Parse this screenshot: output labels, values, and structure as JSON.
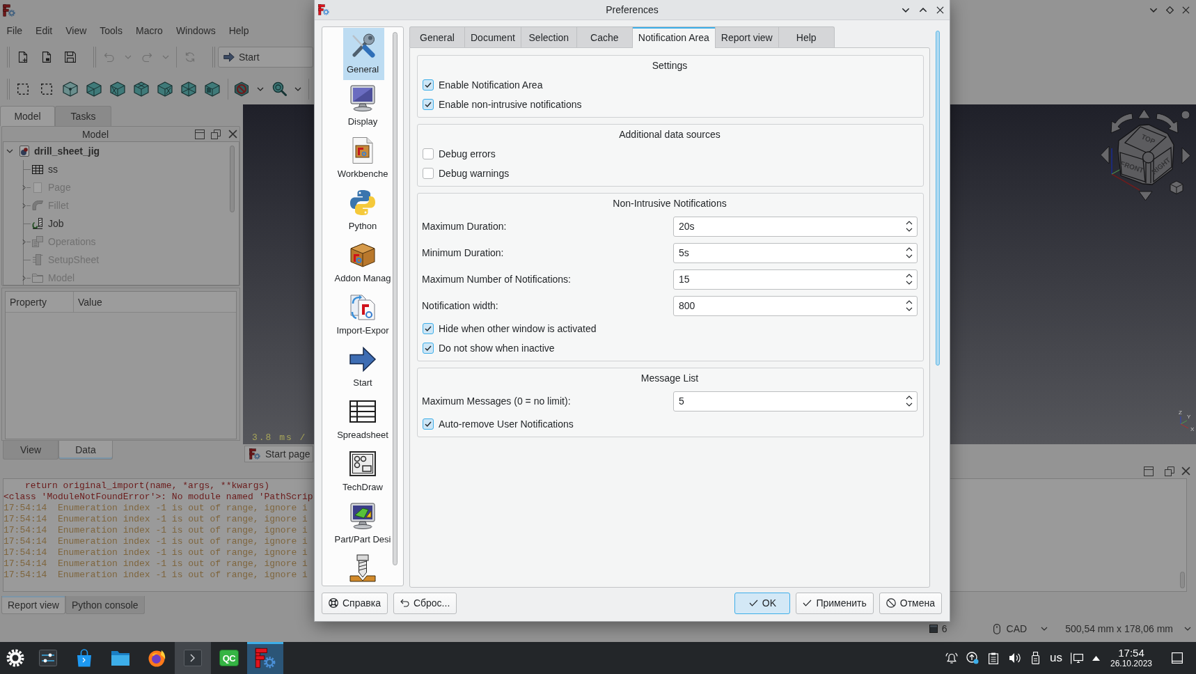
{
  "main_window": {
    "menu": [
      "File",
      "Edit",
      "View",
      "Tools",
      "Macro",
      "Windows",
      "Help"
    ],
    "toolbar": {
      "undo": {
        "disabled": true
      },
      "redo": {
        "disabled": true
      },
      "refresh": {
        "disabled": true
      },
      "workbench": "Start"
    },
    "combo_tabs": [
      {
        "label": "Model",
        "selected": true
      },
      {
        "label": "Tasks",
        "selected": false
      }
    ],
    "model_panel": {
      "title": "Model",
      "tree": {
        "label": "drill_sheet_jig",
        "expanded": true,
        "children": [
          {
            "label": "ss",
            "hidden": false,
            "has_children": false
          },
          {
            "label": "Page",
            "hidden": true,
            "has_children": true
          },
          {
            "label": "Fillet",
            "hidden": true,
            "has_children": true
          },
          {
            "label": "Job",
            "hidden": false,
            "has_children": false
          },
          {
            "label": "Operations",
            "hidden": true,
            "has_children": true
          },
          {
            "label": "SetupSheet",
            "hidden": true,
            "has_children": false
          },
          {
            "label": "Model",
            "hidden": true,
            "has_children": true
          }
        ]
      }
    },
    "property_panel": {
      "columns": [
        "Property",
        "Value"
      ]
    },
    "property_tabs": [
      {
        "label": "View",
        "selected": false
      },
      {
        "label": "Data",
        "selected": true
      }
    ],
    "view_3d": {
      "frame_time": "3.8 ms /",
      "nav_cube": [
        "TOP",
        "FRONT",
        "RIGHT"
      ],
      "axis_labels": [
        "Z",
        "Y",
        "X"
      ]
    },
    "document_tabs": [
      {
        "label": "Start page",
        "selected": true
      }
    ],
    "report_view": {
      "lines": [
        {
          "kind": "traceback",
          "text": "return original_import(name, *args, **kwargs)"
        },
        {
          "kind": "error",
          "text": "<class 'ModuleNotFoundError'>: No module named 'PathScrip"
        },
        {
          "kind": "warning",
          "text": "17:54:14  Enumeration index -1 is out of range, ignore i"
        },
        {
          "kind": "warning",
          "text": "17:54:14  Enumeration index -1 is out of range, ignore i"
        },
        {
          "kind": "warning",
          "text": "17:54:14  Enumeration index -1 is out of range, ignore i"
        },
        {
          "kind": "warning",
          "text": "17:54:14  Enumeration index -1 is out of range, ignore i"
        },
        {
          "kind": "warning",
          "text": "17:54:14  Enumeration index -1 is out of range, ignore i"
        },
        {
          "kind": "warning",
          "text": "17:54:14  Enumeration index -1 is out of range, ignore i"
        },
        {
          "kind": "warning",
          "text": "17:54:14  Enumeration index -1 is out of range, ignore i"
        }
      ]
    },
    "panel_tabs": [
      {
        "label": "Report view",
        "selected": true
      },
      {
        "label": "Python console",
        "selected": false
      }
    ],
    "status_bar": {
      "count": "6",
      "navigation": "CAD",
      "dimensions": "500,54 mm x 178,06 mm"
    }
  },
  "dialog": {
    "title": "Preferences",
    "pages": [
      {
        "label": "General",
        "selected": true
      },
      {
        "label": "Display",
        "selected": false
      },
      {
        "label": "Workbenche",
        "selected": false
      },
      {
        "label": "Python",
        "selected": false
      },
      {
        "label": "Addon Manag",
        "selected": false
      },
      {
        "label": "Import-Expor",
        "selected": false
      },
      {
        "label": "Start",
        "selected": false
      },
      {
        "label": "Spreadsheet",
        "selected": false
      },
      {
        "label": "TechDraw",
        "selected": false
      },
      {
        "label": "Part/Part Desi",
        "selected": false
      },
      {
        "selected": false
      }
    ],
    "tabs": [
      {
        "label": "General",
        "selected": false
      },
      {
        "label": "Document",
        "selected": false
      },
      {
        "label": "Selection",
        "selected": false
      },
      {
        "label": "Cache",
        "selected": false
      },
      {
        "label": "Notification Area",
        "selected": true
      },
      {
        "label": "Report view",
        "selected": false
      },
      {
        "label": "Help",
        "selected": false
      }
    ],
    "groups": [
      {
        "title": "Settings",
        "rows": [
          {
            "kind": "checkbox",
            "label": "Enable Notification Area",
            "checked": true
          },
          {
            "kind": "checkbox",
            "label": "Enable non-intrusive notifications",
            "checked": true
          }
        ]
      },
      {
        "title": "Additional data sources",
        "rows": [
          {
            "kind": "checkbox",
            "label": "Debug errors",
            "checked": false
          },
          {
            "kind": "checkbox",
            "label": "Debug warnings",
            "checked": false
          }
        ]
      },
      {
        "title": "Non-Intrusive Notifications",
        "rows": [
          {
            "kind": "spinbox",
            "label": "Maximum Duration:",
            "value": "20s"
          },
          {
            "kind": "spinbox",
            "label": "Minimum Duration:",
            "value": "5s"
          },
          {
            "kind": "spinbox",
            "label": "Maximum Number of Notifications:",
            "value": "15"
          },
          {
            "kind": "spinbox",
            "label": "Notification width:",
            "value": "800"
          },
          {
            "kind": "checkbox",
            "label": "Hide when other window is activated",
            "checked": true
          },
          {
            "kind": "checkbox",
            "label": "Do not show when inactive",
            "checked": true
          }
        ]
      },
      {
        "title": "Message List",
        "rows": [
          {
            "kind": "spinbox",
            "label": "Maximum Messages (0 = no limit):",
            "value": "5"
          },
          {
            "kind": "checkbox",
            "label": "Auto-remove User Notifications",
            "checked": true
          }
        ]
      }
    ],
    "buttons": [
      {
        "kind": "help",
        "label": "Справка",
        "default": false
      },
      {
        "kind": "reset",
        "label": "Сброс...",
        "default": false
      },
      {
        "kind": "ok",
        "label": "OK",
        "default": true
      },
      {
        "kind": "apply",
        "label": "Применить",
        "default": false
      },
      {
        "kind": "cancel",
        "label": "Отмена",
        "default": false
      }
    ]
  },
  "taskbar": {
    "apps": [
      {
        "open": false,
        "active": false
      },
      {
        "open": false,
        "active": false
      },
      {
        "open": false,
        "active": false
      },
      {
        "open": false,
        "active": false
      },
      {
        "open": true,
        "active": false
      },
      {
        "open": false,
        "active": false,
        "logo_text": "QC"
      },
      {
        "open": true,
        "active": true
      }
    ],
    "keyboard_layout": "us",
    "time": "17:54",
    "date": "26.10.2023"
  }
}
